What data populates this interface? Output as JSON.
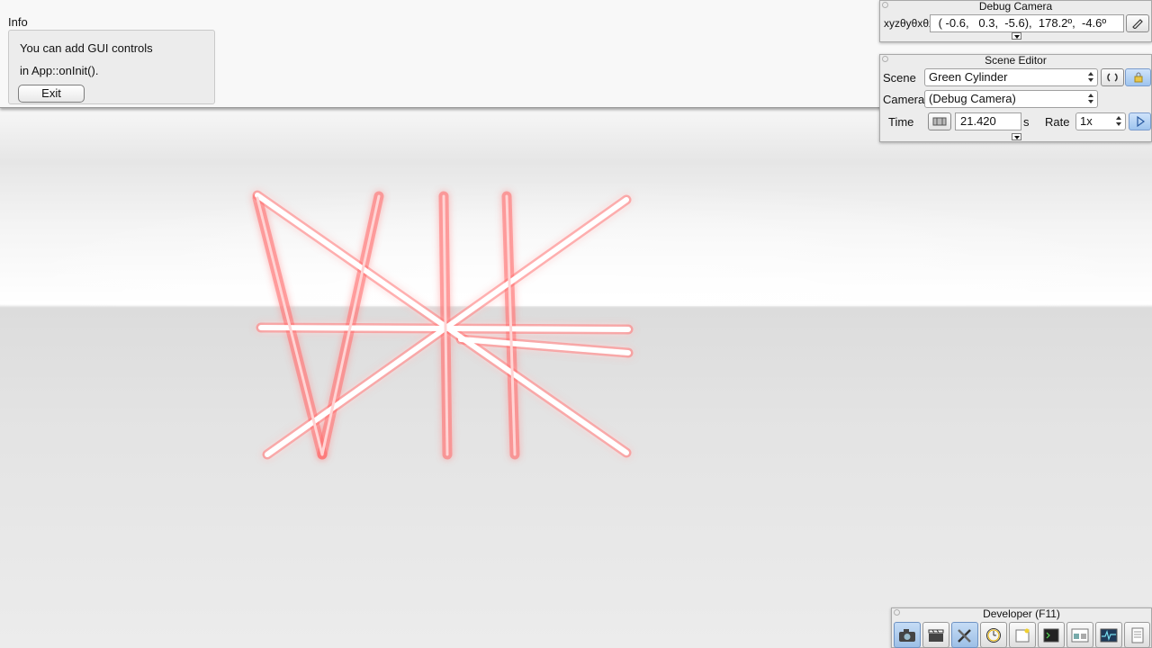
{
  "info": {
    "title": "Info",
    "line1": "You can add GUI controls",
    "line2": "in App::onInit().",
    "exit_label": "Exit"
  },
  "debug_camera": {
    "title": "Debug Camera",
    "xyz_label": "xyzθyθxθz",
    "value": " ( -0.6,   0.3,  -5.6),  178.2º,  -4.6º"
  },
  "scene_editor": {
    "title": "Scene Editor",
    "scene_label": "Scene",
    "scene_value": "Green Cylinder",
    "camera_label": "Camera",
    "camera_value": "(Debug Camera)",
    "time_label": "Time",
    "time_value": "21.420",
    "time_unit": "s",
    "rate_label": "Rate",
    "rate_value": "1x"
  },
  "developer": {
    "title": "Developer (F11)",
    "tools": [
      "camera-icon",
      "clapperboard-icon",
      "tools-icon",
      "clock-icon",
      "window-icon",
      "terminal-icon",
      "layout-icon",
      "profiler-icon",
      "log-icon"
    ]
  },
  "colors": {
    "glow": "#ff3b3b",
    "toolbar_active": "#9dbfe6"
  }
}
